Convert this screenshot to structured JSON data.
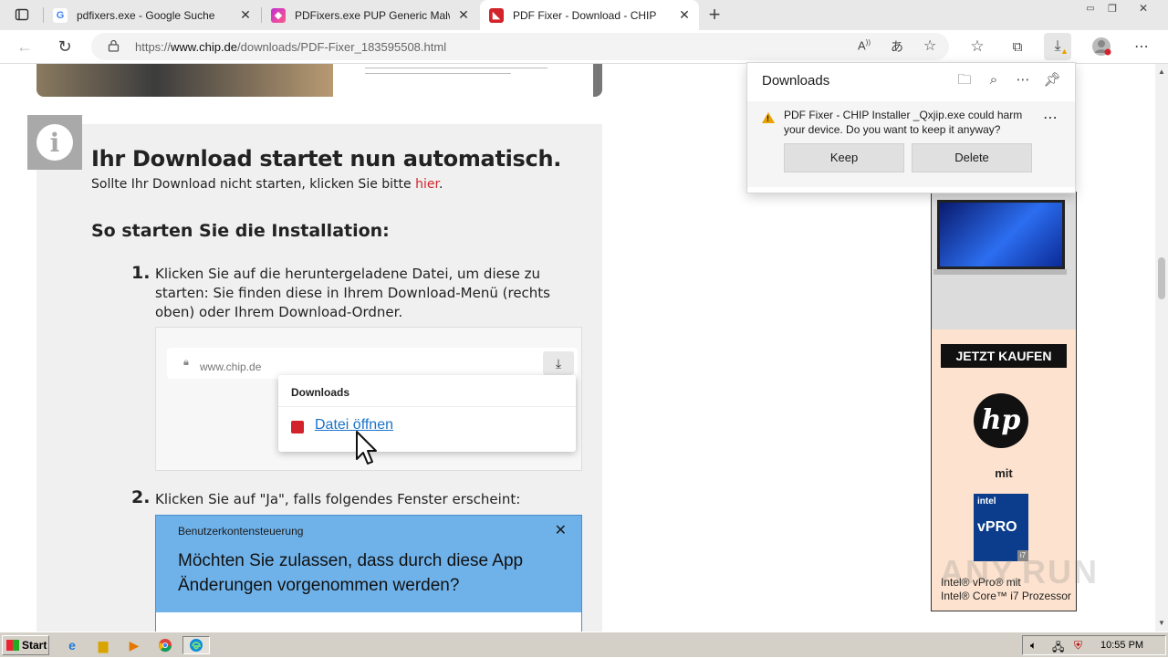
{
  "browser": {
    "tabs": [
      {
        "title": "pdfixers.exe - Google Suche",
        "favicon": "google-icon",
        "active": false
      },
      {
        "title": "PDFixers.exe PUP Generic Malwar",
        "favicon": "anyrun-icon",
        "active": false
      },
      {
        "title": "PDF Fixer - Download - CHIP",
        "favicon": "chip-icon",
        "active": true
      }
    ],
    "url_prefix": "https://",
    "url_domain": "www.chip.de",
    "url_path": "/downloads/PDF-Fixer_183595508.html"
  },
  "downloads_flyout": {
    "title": "Downloads",
    "warning_message": "PDF Fixer - CHIP Installer _Qxjip.exe could harm your device. Do you want to keep it anyway?",
    "keep_label": "Keep",
    "delete_label": "Delete"
  },
  "page": {
    "heading": "Ihr Download startet nun automatisch.",
    "subtext_before": "Sollte Ihr Download nicht starten, klicken Sie bitte ",
    "subtext_link": "hier",
    "subtext_after": ".",
    "install_heading": "So starten Sie die Installation:",
    "steps": [
      {
        "num": "1.",
        "text": "Klicken Sie auf die heruntergeladene Datei, um diese zu starten: Sie finden diese in Ihrem Download-Menü (rechts oben) oder Ihrem Download-Ordner."
      },
      {
        "num": "2.",
        "text": "Klicken Sie auf \"Ja\", falls folgendes Fenster erscheint:"
      }
    ],
    "shot1": {
      "url": "www.chip.de",
      "popup_title": "Downloads",
      "link": "Datei öffnen"
    },
    "shot2": {
      "header": "Benutzerkontensteuerung",
      "question": "Möchten Sie zulassen, dass durch diese App Änderungen vorgenommen  werden?"
    }
  },
  "ad": {
    "buy_label": "JETZT KAUFEN",
    "brand": "hp",
    "mit": "mit",
    "intel_top": "intel",
    "intel_main": "vPRO",
    "intel_badge": "i7",
    "line1": "Intel® vPro® mit",
    "line2": "Intel® Core™ i7 Prozessor"
  },
  "watermark": "ANY.RUN",
  "taskbar": {
    "start_label": "Start",
    "clock": "10:55 PM"
  }
}
